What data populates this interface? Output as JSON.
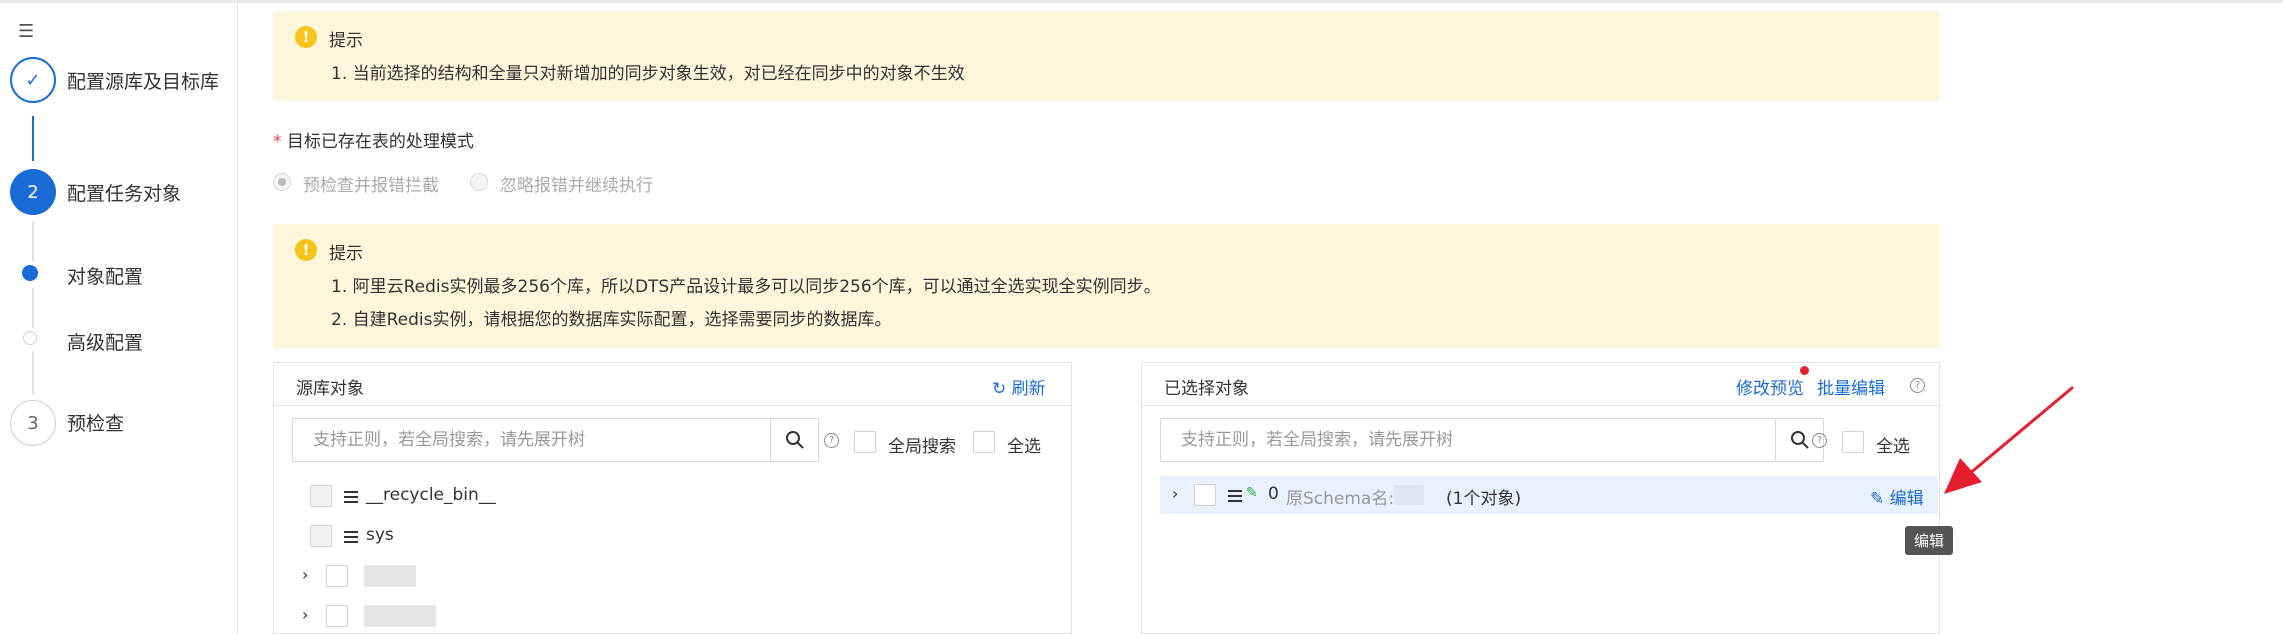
{
  "steps": {
    "step1": {
      "number": "✓",
      "label": "配置源库及目标库"
    },
    "step2": {
      "number": "2",
      "label": "配置任务对象"
    },
    "sub1": {
      "label": "对象配置"
    },
    "sub2": {
      "label": "高级配置"
    },
    "step3": {
      "number": "3",
      "label": "预检查"
    }
  },
  "alert1": {
    "title": "提示",
    "lines": [
      "1. 当前选择的结构和全量只对新增加的同步对象生效，对已经在同步中的对象不生效"
    ]
  },
  "mode": {
    "required_mark": "*",
    "label": "目标已存在表的处理模式",
    "options": [
      "预检查并报错拦截",
      "忽略报错并继续执行"
    ],
    "selected": "预检查并报错拦截"
  },
  "alert2": {
    "title": "提示",
    "lines": [
      "1. 阿里云Redis实例最多256个库，所以DTS产品设计最多可以同步256个库，可以通过全选实现全实例同步。",
      "2. 自建Redis实例，请根据您的数据库实际配置，选择需要同步的数据库。"
    ]
  },
  "source_panel": {
    "title": "源库对象",
    "refresh": "刷新",
    "search_placeholder": "支持正则，若全局搜索，请先展开树",
    "global_search": "全局搜索",
    "select_all": "全选",
    "items": [
      "__recycle_bin__",
      "sys"
    ]
  },
  "selected_panel": {
    "title": "已选择对象",
    "preview": "修改预览",
    "batch_edit": "批量编辑",
    "search_placeholder": "支持正则，若全局搜索，请先展开树",
    "select_all": "全选",
    "row": {
      "index": "0",
      "schema_prefix": "原Schema名: ",
      "count": "(1个对象)",
      "edit": "编辑"
    },
    "tooltip": "编辑"
  },
  "colors": {
    "primary": "#1a6bd6",
    "alert_bg": "#fdf6da",
    "warn": "#f5c31a",
    "arrow": "#e5202e"
  },
  "icons": [
    "collapse-menu-icon",
    "check-icon",
    "warning-icon",
    "refresh-icon",
    "search-icon",
    "help-icon",
    "database-icon",
    "pencil-icon",
    "chevron-right-icon",
    "red-arrow"
  ]
}
